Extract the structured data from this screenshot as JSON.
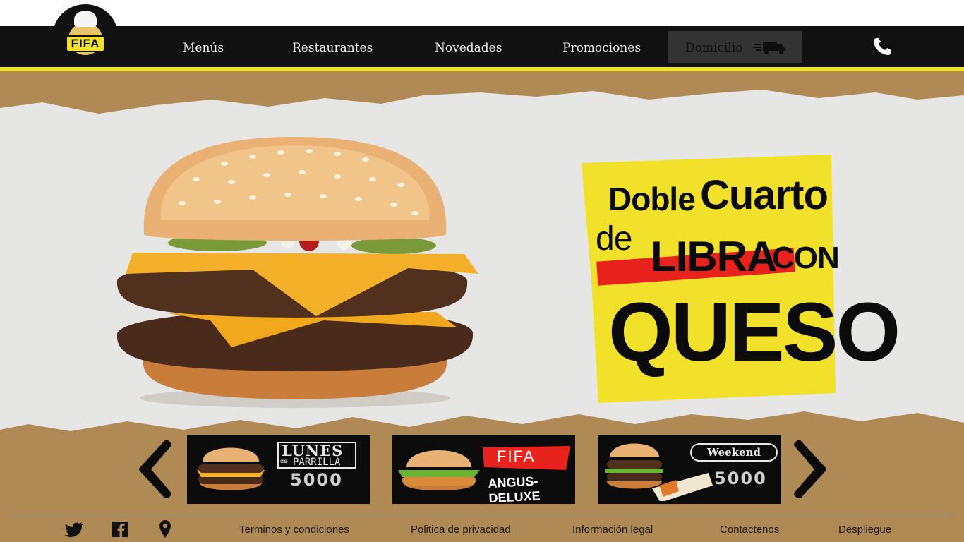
{
  "brand": {
    "logo_text": "FIFA"
  },
  "nav": {
    "items": [
      "Menús",
      "Restaurantes",
      "Novedades",
      "Promociones"
    ],
    "delivery_label": "Domicilio",
    "delivery_icon": "truck-icon",
    "phone_icon": "phone-icon"
  },
  "colors": {
    "accent_yellow": "#f2e12a",
    "nav_black": "#111111",
    "kraft": "#b08a55",
    "promo_red": "#e8231e"
  },
  "hero": {
    "promo": {
      "line1a": "Doble",
      "line1b": "Cuarto",
      "line2a": "de",
      "line2b": "LIBRA",
      "line2c": "CON",
      "line3": "QUESO"
    }
  },
  "carousel": {
    "prev_icon": "chevron-left-icon",
    "next_icon": "chevron-right-icon",
    "cards": [
      {
        "title": "LUNES",
        "subtitle_small": "de",
        "subtitle": "PARRILLA",
        "price": "5000"
      },
      {
        "title": "FIFA",
        "subtitle": "ANGUS-DELUXE"
      },
      {
        "title": "Weekend",
        "price": "5000"
      }
    ]
  },
  "footer": {
    "social_icons": [
      "twitter-icon",
      "facebook-icon",
      "location-pin-icon"
    ],
    "links": [
      "Terminos y condiciones",
      "Politica de privacidad",
      "Información legal",
      "Contactenos",
      "Despliegue"
    ]
  }
}
